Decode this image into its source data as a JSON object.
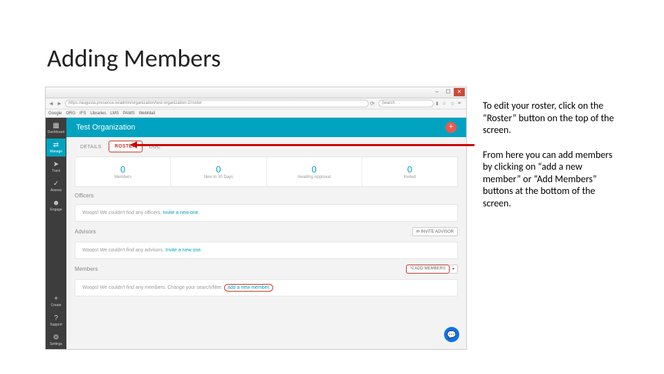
{
  "slide": {
    "title": "Adding Members"
  },
  "explain": {
    "p1": "To edit your roster, click on the “Roster” button on the top of the screen.",
    "p2": "From here you can add members by clicking on “add a new member” or “Add Members” buttons at the bottom of the screen."
  },
  "browser": {
    "url": "https://augusta.presence.io/admin/organization/test-organization-2/roster",
    "search_placeholder": "Search",
    "bookmarks": [
      "Google",
      "ORG",
      "IFS",
      "Libraries",
      "LMS",
      "PAWS",
      "WebMail"
    ]
  },
  "sidebar": {
    "items": [
      {
        "icon": "▦",
        "label": "Dashboard"
      },
      {
        "icon": "⇄",
        "label": "Manage"
      },
      {
        "icon": "➤",
        "label": "Track"
      },
      {
        "icon": "✓",
        "label": "Assess"
      },
      {
        "icon": "☻",
        "label": "Engage"
      }
    ],
    "bottom": [
      {
        "icon": "+",
        "label": "Create"
      },
      {
        "icon": "?",
        "label": "Support"
      },
      {
        "icon": "⚙",
        "label": "Settings"
      }
    ]
  },
  "header": {
    "org_title": "Test Organization"
  },
  "tabs": {
    "details": "DETAILS",
    "roster": "ROSTER",
    "doc": "DOC"
  },
  "stats": [
    {
      "num": "0",
      "label": "Members"
    },
    {
      "num": "0",
      "label": "New In 30 Days"
    },
    {
      "num": "0",
      "label": "Awaiting Approval"
    },
    {
      "num": "0",
      "label": "Invited"
    }
  ],
  "sections": {
    "officers": {
      "title": "Officers",
      "msg": "Woops! We couldn't find any officers.",
      "link": "Invite a new one."
    },
    "advisors": {
      "title": "Advisors",
      "invite_btn": "✉ INVITE ADVISOR",
      "msg": "Woops! We couldn't find any advisors.",
      "link": "Invite a new one."
    },
    "members": {
      "title": "Members",
      "add_btn": "⤭ ADD MEMBERS",
      "drop": "▾",
      "msg": "Woops! We couldn't find any members. Change your search/filter.",
      "link": "add a new member."
    }
  }
}
